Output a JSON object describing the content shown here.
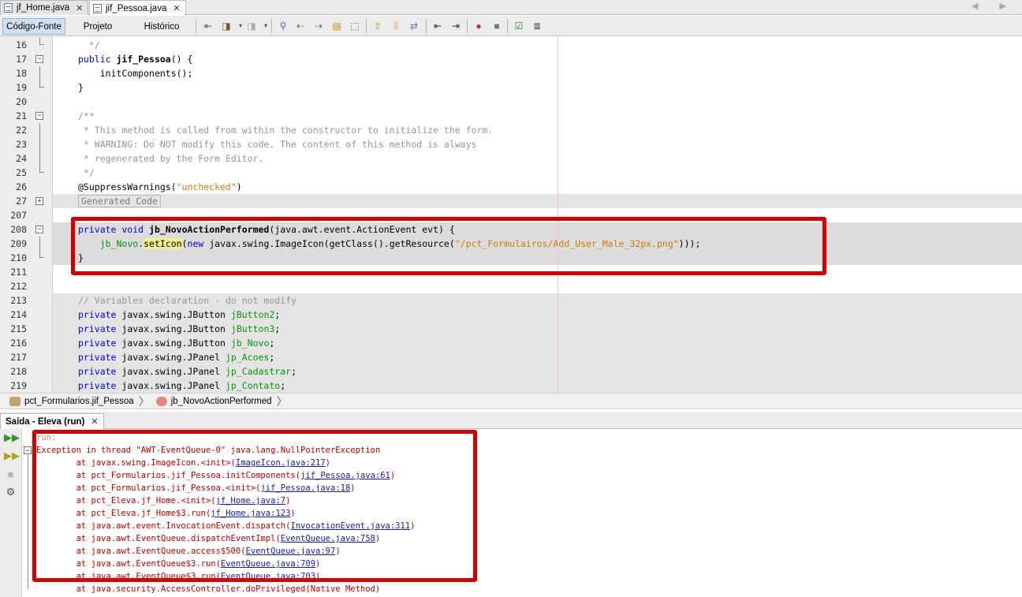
{
  "editor_tabs": [
    {
      "label": "jf_Home.java",
      "close": "✕"
    },
    {
      "label": "jif_Pessoa.java",
      "close": "✕"
    }
  ],
  "view_tabs": [
    "Código-Fonte",
    "Projeto",
    "Histórico"
  ],
  "tab_nav": "◀ ▶",
  "gutter": {
    "line_numbers": [
      "16",
      "17",
      "18",
      "19",
      "20",
      "21",
      "22",
      "23",
      "24",
      "25",
      "26",
      "27",
      "207",
      "208",
      "209",
      "210",
      "211",
      "212",
      "213",
      "214",
      "215",
      "216",
      "217",
      "218",
      "219"
    ]
  },
  "code": {
    "l16": "*/",
    "l17_kw": "public",
    "l17_rest": "jif_Pessoa",
    "l17_tail": "() {",
    "l18": "initComponents();",
    "l19": "}",
    "l21": "/**",
    "l22": "* This method is called from within the constructor to initialize the form.",
    "l23": "* WARNING: Do NOT modify this code. The content of this method is always",
    "l24": "* regenerated by the Form Editor.",
    "l25": "*/",
    "l26_ann": "@SuppressWarnings(",
    "l26_str": "\"unchecked\"",
    "l26_end": ")",
    "l27": "Generated Code",
    "l208_kw": "private void",
    "l208_fn": "jb_NovoActionPerformed",
    "l208_rest": "(java.awt.event.ActionEvent evt) {",
    "l209_fld": "jb_Novo",
    "l209_dot": ".",
    "l209_mt": "setIcon",
    "l209_a": "(",
    "l209_new": "new",
    "l209_b": " javax.swing.ImageIcon(getClass().getResource(",
    "l209_str": "\"/pct_Formulairos/Add_User_Male_32px.png\"",
    "l209_c": ")));",
    "l210": "}",
    "l213": "// Variables declaration - do not modify",
    "decls": [
      {
        "kw": "private",
        "type": "javax.swing.JButton",
        "name": "jButton2"
      },
      {
        "kw": "private",
        "type": "javax.swing.JButton",
        "name": "jButton3"
      },
      {
        "kw": "private",
        "type": "javax.swing.JButton",
        "name": "jb_Novo"
      },
      {
        "kw": "private",
        "type": "javax.swing.JPanel",
        "name": "jp_Acoes"
      },
      {
        "kw": "private",
        "type": "javax.swing.JPanel",
        "name": "jp_Cadastrar"
      },
      {
        "kw": "private",
        "type": "javax.swing.JPanel",
        "name": "jp_Contato"
      }
    ],
    "semicolon": ";"
  },
  "breadcrumb": [
    "pct_Formularios.jif_Pessoa",
    "jb_NovoActionPerformed"
  ],
  "output": {
    "tab_label": "Saída - Eleva (run)",
    "run": "run:",
    "exception": "Exception in thread \"AWT-EventQueue-0\" java.lang.NullPointerException",
    "frames": [
      {
        "at": "at javax.swing.ImageIcon.<init>(",
        "link": "ImageIcon.java:217",
        "end": ")"
      },
      {
        "at": "at pct_Formularios.jif_Pessoa.initComponents(",
        "link": "jif_Pessoa.java:61",
        "end": ")"
      },
      {
        "at": "at pct_Formularios.jif_Pessoa.<init>(",
        "link": "jif_Pessoa.java:18",
        "end": ")"
      },
      {
        "at": "at pct_Eleva.jf_Home.<init>(",
        "link": "jf_Home.java:7",
        "end": ")"
      },
      {
        "at": "at pct_Eleva.jf_Home$3.run(",
        "link": "jf_Home.java:123",
        "end": ")"
      },
      {
        "at": "at java.awt.event.InvocationEvent.dispatch(",
        "link": "InvocationEvent.java:311",
        "end": ")"
      },
      {
        "at": "at java.awt.EventQueue.dispatchEventImpl(",
        "link": "EventQueue.java:758",
        "end": ")"
      },
      {
        "at": "at java.awt.EventQueue.access$500(",
        "link": "EventQueue.java:97",
        "end": ")"
      },
      {
        "at": "at java.awt.EventQueue$3.run(",
        "link": "EventQueue.java:709",
        "end": ")"
      },
      {
        "at": "at java.awt.EventQueue$3.run(",
        "link": "EventQueue.java:703",
        "end": ")"
      },
      {
        "at": "at java.security.AccessController.doPrivileged(",
        "link": "Native Method",
        "end": ")"
      }
    ]
  },
  "colors": {
    "highlight_box": "#d40000",
    "keyword": "#0000e6",
    "string": "#ce7b00",
    "field": "#009900",
    "comment": "#969696",
    "error_text": "#c00000"
  }
}
